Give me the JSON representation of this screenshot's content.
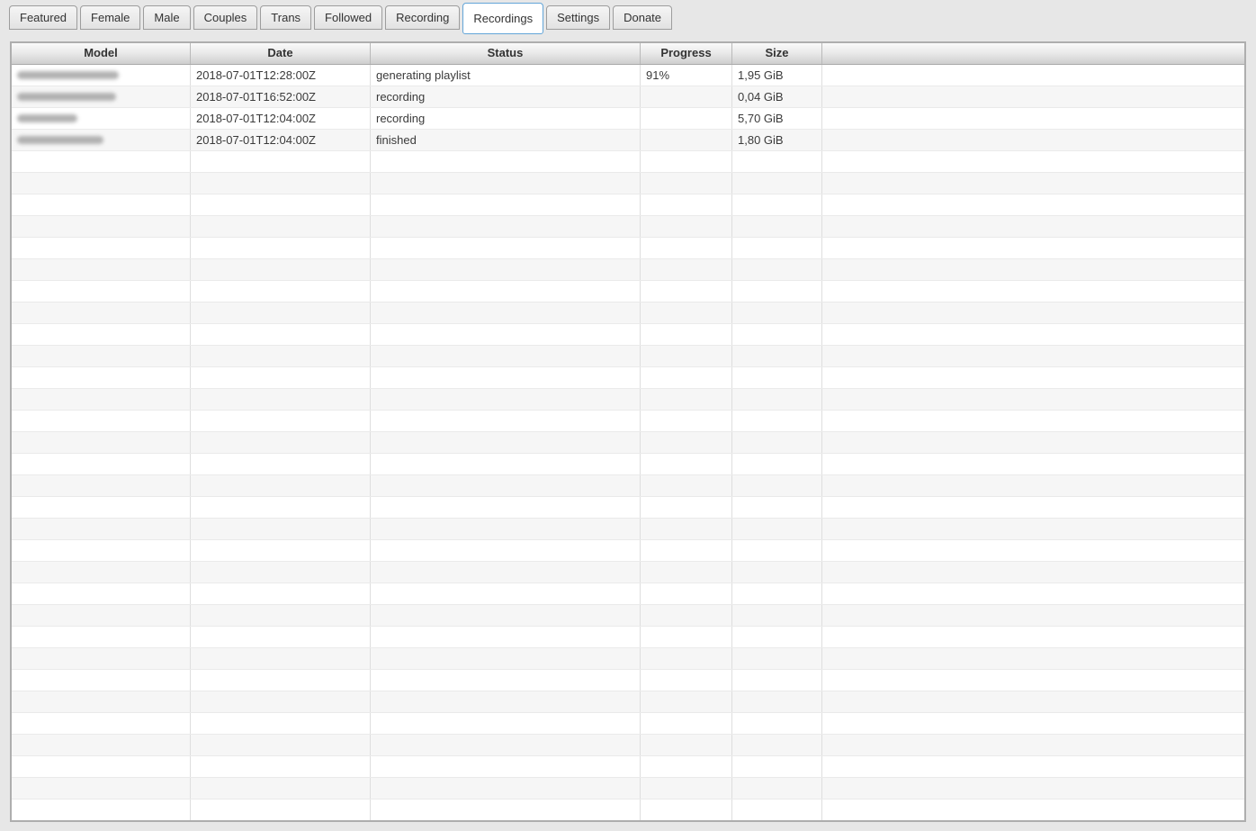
{
  "tabs": {
    "items": [
      {
        "label": "Featured",
        "selected": false
      },
      {
        "label": "Female",
        "selected": false
      },
      {
        "label": "Male",
        "selected": false
      },
      {
        "label": "Couples",
        "selected": false
      },
      {
        "label": "Trans",
        "selected": false
      },
      {
        "label": "Followed",
        "selected": false
      },
      {
        "label": "Recording",
        "selected": false
      },
      {
        "label": "Recordings",
        "selected": true
      },
      {
        "label": "Settings",
        "selected": false
      },
      {
        "label": "Donate",
        "selected": false
      }
    ]
  },
  "table": {
    "columns": [
      {
        "key": "model",
        "label": "Model"
      },
      {
        "key": "date",
        "label": "Date"
      },
      {
        "key": "status",
        "label": "Status"
      },
      {
        "key": "progress",
        "label": "Progress"
      },
      {
        "key": "size",
        "label": "Size"
      },
      {
        "key": "extra",
        "label": ""
      }
    ],
    "rows": [
      {
        "model_redacted": true,
        "model_blur_width": 113,
        "date": "2018-07-01T12:28:00Z",
        "status": "generating playlist",
        "progress": "91%",
        "size": "1,95 GiB"
      },
      {
        "model_redacted": true,
        "model_blur_width": 110,
        "date": "2018-07-01T16:52:00Z",
        "status": "recording",
        "progress": "",
        "size": "0,04 GiB"
      },
      {
        "model_redacted": true,
        "model_blur_width": 67,
        "date": "2018-07-01T12:04:00Z",
        "status": "recording",
        "progress": "",
        "size": "5,70 GiB"
      },
      {
        "model_redacted": true,
        "model_blur_width": 96,
        "date": "2018-07-01T12:04:00Z",
        "status": "finished",
        "progress": "",
        "size": "1,80 GiB"
      }
    ],
    "empty_row_count": 31
  },
  "colors": {
    "selected_tab_border": "#63a5d8",
    "zebra_even_row": "#f6f6f6",
    "header_text": "#333333",
    "cell_text": "#3a3a3a",
    "page_background": "#e7e7e7"
  }
}
